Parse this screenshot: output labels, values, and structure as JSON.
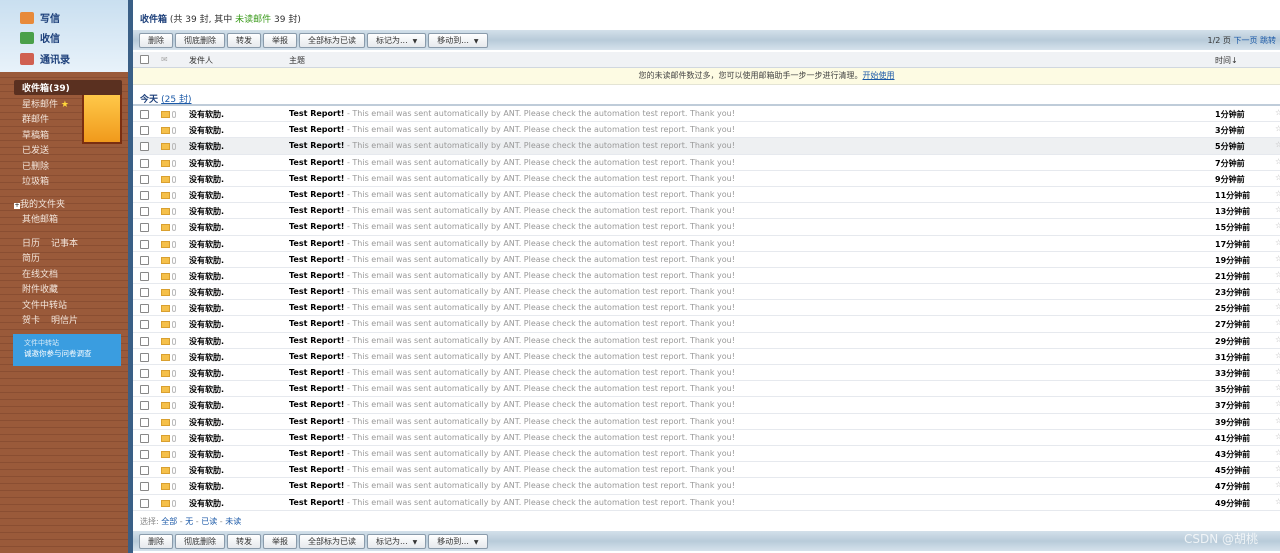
{
  "sidebar": {
    "compose": "写信",
    "receive": "收信",
    "contacts": "通讯录",
    "inbox": "收件箱(39)",
    "starred": "星标邮件",
    "group": "群邮件",
    "drafts": "草稿箱",
    "sent": "已发送",
    "deleted": "已删除",
    "trash": "垃圾箱",
    "my_folders": "我的文件夹",
    "other_mail": "其他邮箱",
    "calendar": "日历",
    "notes": "记事本",
    "resume": "简历",
    "docs": "在线文档",
    "attachments": "附件收藏",
    "transfer": "文件中转站",
    "cards": "贺卡",
    "postcards": "明信片",
    "ad_title": "文件中转站",
    "ad_text": "诚邀你参与问卷调查"
  },
  "header": {
    "folder": "收件箱",
    "count_text": "(共 39 封, 其中 ",
    "unread_label": "未读邮件",
    "unread_count": " 39 封)"
  },
  "toolbar": {
    "delete": "删除",
    "perm_delete": "彻底删除",
    "forward": "转发",
    "report": "举报",
    "mark_all_read": "全部标为已读",
    "mark_as": "标记为...",
    "move_to": "移动到...",
    "page": "1/2 页",
    "next": "下一页",
    "jump": "跳转"
  },
  "columns": {
    "sender": "发件人",
    "subject": "主题",
    "time": "时间↓"
  },
  "notice": {
    "text": "您的未读邮件数过多，您可以使用邮箱助手一步一步进行清理。",
    "link": "开始使用"
  },
  "group": {
    "label": "今天",
    "count": "(25 封)"
  },
  "select": {
    "label": "选择:",
    "all": "全部",
    "none": "无",
    "read": "已读",
    "unread": "未读"
  },
  "watermark": "CSDN @胡桃",
  "email_template": {
    "sender": "没有软肋.",
    "subject": "Test Report!",
    "preview": " - This email was sent automatically by ANT. Please check the automation test report. Thank you!"
  },
  "emails": [
    {
      "time": "1分钟前"
    },
    {
      "time": "3分钟前"
    },
    {
      "time": "5分钟前"
    },
    {
      "time": "7分钟前"
    },
    {
      "time": "9分钟前"
    },
    {
      "time": "11分钟前"
    },
    {
      "time": "13分钟前"
    },
    {
      "time": "15分钟前"
    },
    {
      "time": "17分钟前"
    },
    {
      "time": "19分钟前"
    },
    {
      "time": "21分钟前"
    },
    {
      "time": "23分钟前"
    },
    {
      "time": "25分钟前"
    },
    {
      "time": "27分钟前"
    },
    {
      "time": "29分钟前"
    },
    {
      "time": "31分钟前"
    },
    {
      "time": "33分钟前"
    },
    {
      "time": "35分钟前"
    },
    {
      "time": "37分钟前"
    },
    {
      "time": "39分钟前"
    },
    {
      "time": "41分钟前"
    },
    {
      "time": "43分钟前"
    },
    {
      "time": "45分钟前"
    },
    {
      "time": "47分钟前"
    },
    {
      "time": "49分钟前"
    }
  ]
}
